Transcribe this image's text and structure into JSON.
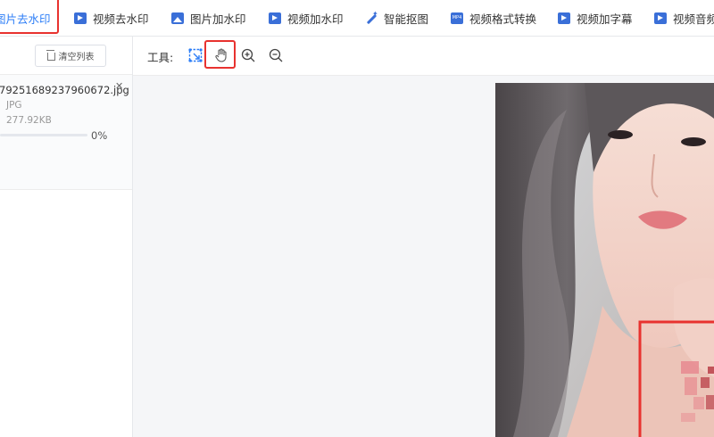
{
  "topnav": {
    "tabs": [
      {
        "label": "图片去水印",
        "icon": "image-icon",
        "active": true
      },
      {
        "label": "视频去水印",
        "icon": "video-icon"
      },
      {
        "label": "图片加水印",
        "icon": "image-icon"
      },
      {
        "label": "视频加水印",
        "icon": "video-icon"
      },
      {
        "label": "智能抠图",
        "icon": "magic-wand-icon"
      },
      {
        "label": "视频格式转换",
        "icon": "mp4-file-icon"
      },
      {
        "label": "视频加字幕",
        "icon": "video-icon"
      },
      {
        "label": "视频音频",
        "icon": "video-icon"
      }
    ]
  },
  "left_panel": {
    "clear_button_label": "清空列表",
    "file": {
      "name": "79251689237960672.jpg",
      "type": "JPG",
      "size": "277.92KB",
      "progress_label": "0%",
      "progress": 0
    }
  },
  "toolbar": {
    "label": "工具:",
    "tools": [
      "select-region-icon",
      "hand-pan-icon",
      "zoom-in-icon",
      "zoom-out-icon"
    ]
  },
  "colors": {
    "accent": "#2d7ef7",
    "highlight": "#e8322f",
    "watermark_mosaic": "#e88a8f"
  }
}
